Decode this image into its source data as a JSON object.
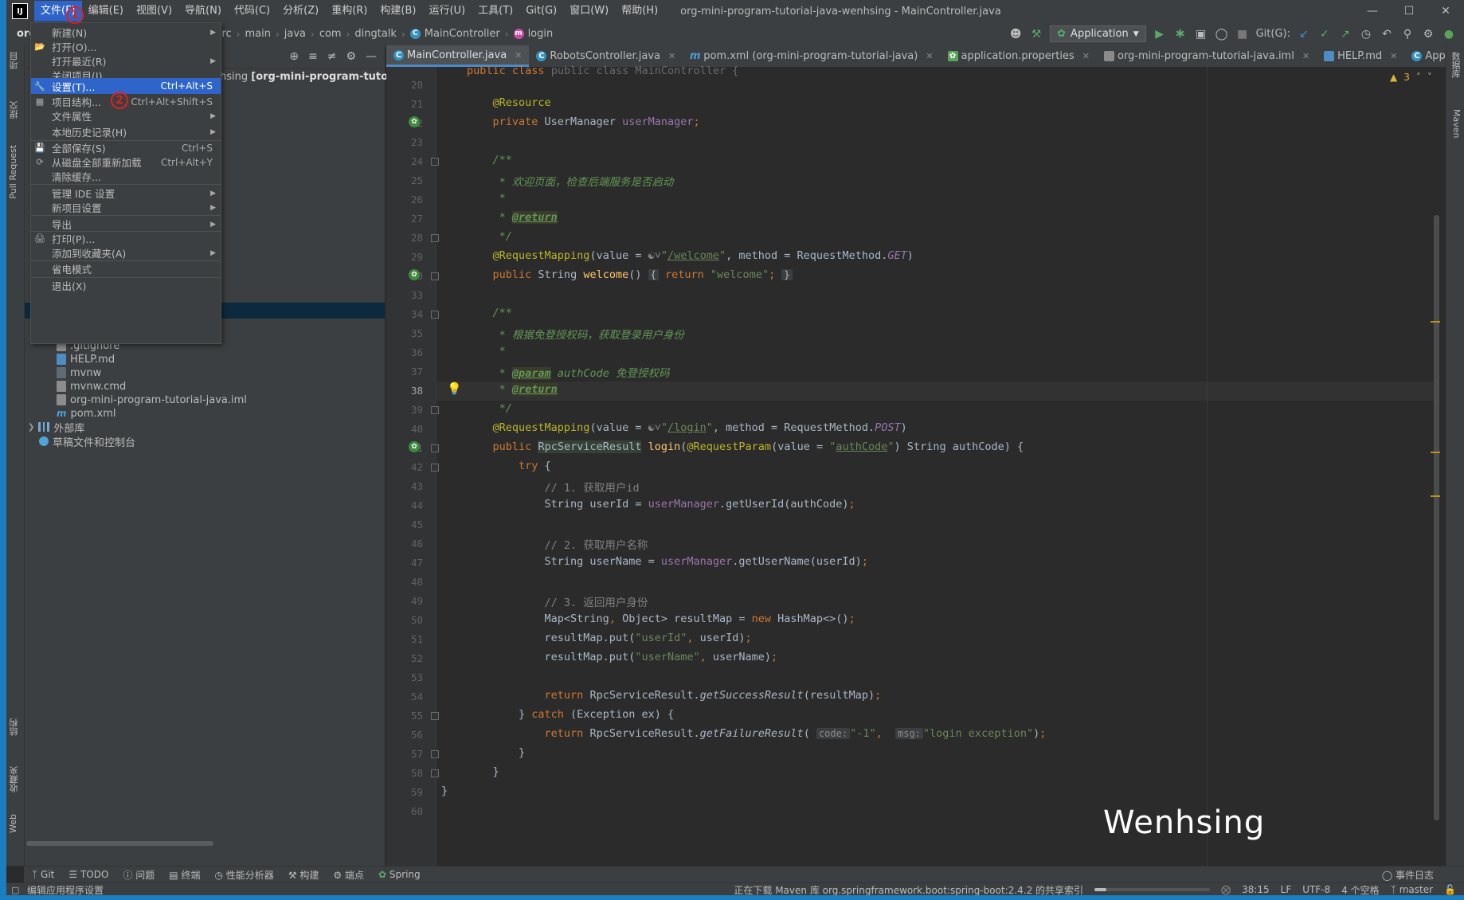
{
  "menubar": {
    "logo": "IJ",
    "items": [
      "文件(F)",
      "编辑(E)",
      "视图(V)",
      "导航(N)",
      "代码(C)",
      "分析(Z)",
      "重构(R)",
      "构建(B)",
      "运行(U)",
      "工具(T)",
      "Git(G)",
      "窗口(W)",
      "帮助(H)"
    ],
    "window_title": "org-mini-program-tutorial-java-wenhsing - MainController.java"
  },
  "navbar": {
    "crumbs": [
      "org",
      "src",
      "main",
      "java",
      "com",
      "dingtalk",
      "MainController",
      "login"
    ],
    "run_config": "Application",
    "git_label": "Git(G):"
  },
  "file_menu": {
    "items": [
      {
        "label": "新建(N)",
        "shortcut": "",
        "arrow": true
      },
      {
        "label": "打开(O)...",
        "shortcut": "",
        "arrow": false
      },
      {
        "label": "打开最近(R)",
        "shortcut": "",
        "arrow": true
      },
      {
        "label": "关闭项目(J)",
        "shortcut": "",
        "arrow": false
      },
      {
        "label": "设置(T)...",
        "shortcut": "Ctrl+Alt+S",
        "arrow": false
      },
      {
        "label": "项目结构...",
        "shortcut": "Ctrl+Alt+Shift+S",
        "arrow": false
      },
      {
        "label": "文件属性",
        "shortcut": "",
        "arrow": true
      },
      {
        "label": "本地历史记录(H)",
        "shortcut": "",
        "arrow": true
      },
      {
        "label": "全部保存(S)",
        "shortcut": "Ctrl+S",
        "arrow": false
      },
      {
        "label": "从磁盘全部重新加载",
        "shortcut": "Ctrl+Alt+Y",
        "arrow": false
      },
      {
        "label": "清除缓存...",
        "shortcut": "",
        "arrow": false
      },
      {
        "label": "管理 IDE 设置",
        "shortcut": "",
        "arrow": true
      },
      {
        "label": "新项目设置",
        "shortcut": "",
        "arrow": true
      },
      {
        "label": "导出",
        "shortcut": "",
        "arrow": true
      },
      {
        "label": "打印(P)...",
        "shortcut": "",
        "arrow": false
      },
      {
        "label": "添加到收藏夹(A)",
        "shortcut": "",
        "arrow": true
      },
      {
        "label": "省电模式",
        "shortcut": "",
        "arrow": false
      },
      {
        "label": "退出(X)",
        "shortcut": "",
        "arrow": false
      }
    ],
    "annotation_1": "1",
    "annotation_2": "2"
  },
  "project": {
    "title_suffix": "hsing",
    "title_module": "[org-mini-program-tutorial",
    "tree": [
      ".gitignore",
      "HELP.md",
      "mvnw",
      "mvnw.cmd",
      "org-mini-program-tutorial-java.iml",
      "pom.xml",
      "外部库",
      "草稿文件和控制台"
    ]
  },
  "left_strip": {
    "project": "项目",
    "commit": "提交",
    "pull_requests": "Pull Request",
    "structure": "结构",
    "favorites": "收藏夹",
    "web": "Web"
  },
  "right_strip": {
    "database": "数据库",
    "maven": "Maven"
  },
  "tabs": [
    {
      "label": "MainController.java",
      "icon": "c"
    },
    {
      "label": "RobotsController.java",
      "icon": "c"
    },
    {
      "label": "pom.xml (org-mini-program-tutorial-java)",
      "icon": "m"
    },
    {
      "label": "application.properties",
      "icon": "p"
    },
    {
      "label": "org-mini-program-tutorial-java.iml",
      "icon": "i"
    },
    {
      "label": "HELP.md",
      "icon": "h"
    },
    {
      "label": "AppConstant.java",
      "icon": "c"
    }
  ],
  "editor": {
    "line_numbers": [
      "20",
      "21",
      "22",
      "23",
      "24",
      "25",
      "26",
      "27",
      "28",
      "29",
      "30",
      "33",
      "34",
      "35",
      "36",
      "37",
      "38",
      "39",
      "40",
      "41",
      "42",
      "43",
      "44",
      "45",
      "46",
      "47",
      "48",
      "49",
      "50",
      "51",
      "52",
      "53",
      "54",
      "55",
      "56",
      "57",
      "58",
      "59",
      "60"
    ],
    "current_line": "38",
    "warnings": "3",
    "top_fragment": "public class MainController {",
    "hint_code": "code:",
    "hint_msg": "msg:"
  },
  "watermark": "Wenhsing",
  "tool_tabs": [
    "Git",
    "TODO",
    "问题",
    "终端",
    "性能分析器",
    "构建",
    "端点",
    "Spring"
  ],
  "event_log": "事件日志",
  "status": {
    "left": "编辑应用程序设置",
    "download": "正在下载 Maven 库 org.springframework.boot:spring-boot:2.4.2 的共享索引",
    "download_progress": 0.1,
    "position": "38:15",
    "line_sep": "LF",
    "encoding": "UTF-8",
    "indent": "4 个空格",
    "branch": "master"
  }
}
